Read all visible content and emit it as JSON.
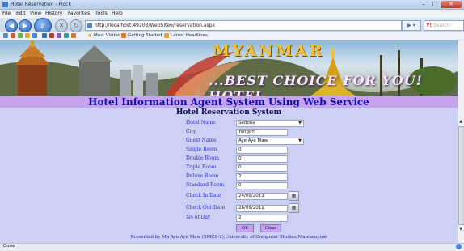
{
  "window": {
    "title": "Hotel Reservation - Flock"
  },
  "menu": [
    "File",
    "Edit",
    "View",
    "History",
    "Favorites",
    "Tools",
    "Help"
  ],
  "address": {
    "url": "http://localhost:49203/WebSite6/reservation.aspx"
  },
  "search": {
    "placeholder": "Search"
  },
  "favorites": [
    "Most Visited",
    "Getting Started",
    "Latest Headlines"
  ],
  "banner": {
    "title": "MYANMAR",
    "subtitle": "...BEST CHOICE FOR YOU! HOTEL"
  },
  "page": {
    "heading": "Hotel Information Agent System Using Web Service",
    "subheading": "Hotel Reservation System"
  },
  "form": {
    "hotel_name": {
      "label": "Hotel Name",
      "value": "Sedona"
    },
    "city": {
      "label": "City",
      "value": "Yangon"
    },
    "guest_name": {
      "label": "Guest Name",
      "value": "Aye Aye Maw"
    },
    "single_room": {
      "label": "Single Room",
      "value": "0"
    },
    "double_room": {
      "label": "Double Room",
      "value": "0"
    },
    "triple_room": {
      "label": "Triple Room",
      "value": "0"
    },
    "deluxe_room": {
      "label": "Deluxe Room",
      "value": "2"
    },
    "standard_room": {
      "label": "Standard Room",
      "value": "0"
    },
    "check_in": {
      "label": "Check In Date",
      "value": "24/09/2011"
    },
    "check_out": {
      "label": "Check Out Date",
      "value": "26/09/2011"
    },
    "no_of_day": {
      "label": "No of Day",
      "value": "2"
    },
    "ok_label": "OK",
    "clear_label": "Clear"
  },
  "footer": {
    "text": "Presented by Ma Aye Aye Maw (5MCS-2),University of Computer Studies,Mawlamyine"
  },
  "status": {
    "text": "Done"
  }
}
